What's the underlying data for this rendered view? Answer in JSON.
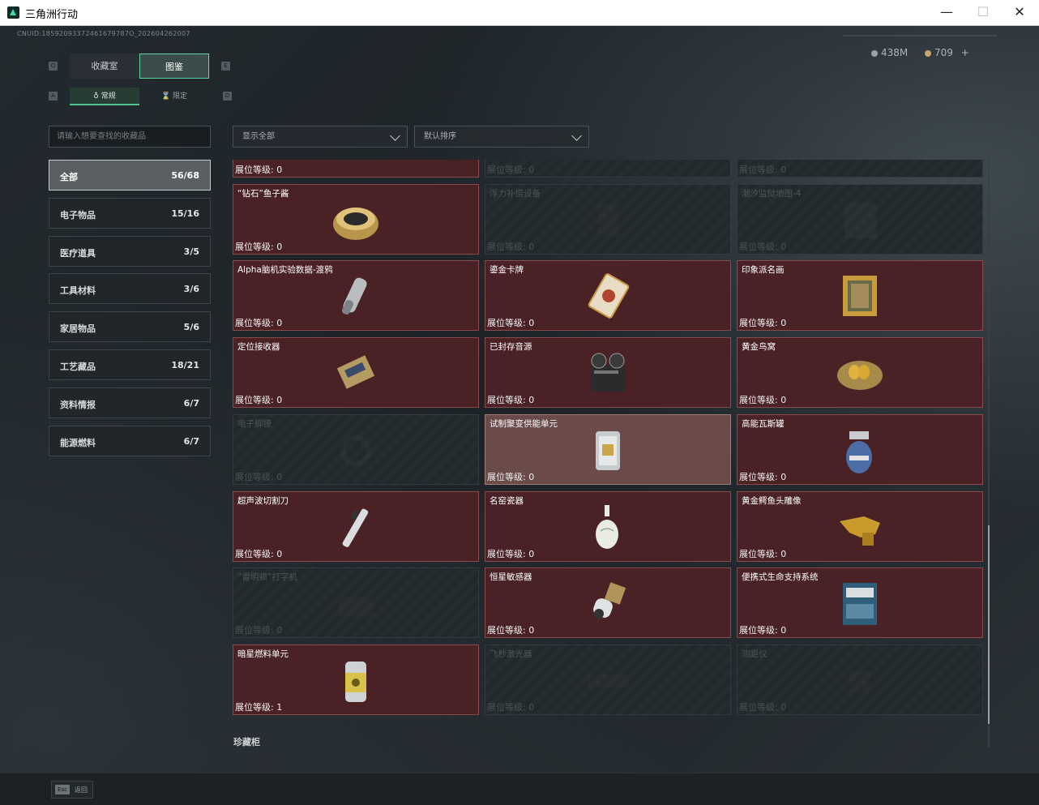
{
  "window": {
    "title": "三角洲行动",
    "minimize": "—",
    "maximize": "☐",
    "close": "✕"
  },
  "header": {
    "uid": "CNUID:18592093372461679787O_202604262007",
    "currency1": "438M",
    "currency2": "709",
    "currency2_add": "+",
    "currency1_color": "#9aa3a8",
    "currency2_color": "#c7a66a"
  },
  "tabs": {
    "collection_room": "收藏室",
    "catalog": "图鉴",
    "left_key": "Q",
    "right_key": "E"
  },
  "subtabs": {
    "regular": "常规",
    "limited": "限定",
    "left_key": "A",
    "right_key": "D"
  },
  "search": {
    "placeholder": "请输入想要查找的收藏品"
  },
  "filters": {
    "display": "显示全部",
    "sort": "默认排序"
  },
  "categories": [
    {
      "label": "全部",
      "count": "56/68",
      "active": true
    },
    {
      "label": "电子物品",
      "count": "15/16"
    },
    {
      "label": "医疗道具",
      "count": "3/5"
    },
    {
      "label": "工具材料",
      "count": "3/6"
    },
    {
      "label": "家居物品",
      "count": "5/6"
    },
    {
      "label": "工艺藏品",
      "count": "18/21"
    },
    {
      "label": "资料情报",
      "count": "6/7"
    },
    {
      "label": "能源燃料",
      "count": "6/7"
    }
  ],
  "items": [
    {
      "name": "",
      "level": "展位等级: 0",
      "locked": false,
      "icon": "gold-item-icon"
    },
    {
      "name": "",
      "level": "展位等级: 0",
      "locked": true,
      "icon": "unknown-icon"
    },
    {
      "name": "",
      "level": "展位等级: 0",
      "locked": true,
      "icon": "unknown-icon"
    },
    {
      "name": "“钻石”鱼子酱",
      "level": "展位等级: 0",
      "locked": false,
      "icon": "caviar-tin-icon"
    },
    {
      "name": "浮力补偿设备",
      "level": "展位等级: 0",
      "locked": true,
      "icon": "bcd-icon"
    },
    {
      "name": "潮汐监狱地图-4",
      "level": "展位等级: 0",
      "locked": true,
      "icon": "map-icon"
    },
    {
      "name": "Alpha脑机实验数据-渡鸦",
      "level": "展位等级: 0",
      "locked": false,
      "icon": "data-cylinder-icon"
    },
    {
      "name": "鎏金卡牌",
      "level": "展位等级: 0",
      "locked": false,
      "icon": "gilded-card-icon"
    },
    {
      "name": "印象派名画",
      "level": "展位等级: 0",
      "locked": false,
      "icon": "painting-icon"
    },
    {
      "name": "定位接收器",
      "level": "展位等级: 0",
      "locked": false,
      "icon": "receiver-icon"
    },
    {
      "name": "已封存音源",
      "level": "展位等级: 0",
      "locked": false,
      "icon": "reel-recorder-icon"
    },
    {
      "name": "黄金鸟窝",
      "level": "展位等级: 0",
      "locked": false,
      "icon": "golden-nest-icon"
    },
    {
      "name": "电子脚镣",
      "level": "展位等级: 0",
      "locked": true,
      "icon": "ankle-monitor-icon"
    },
    {
      "name": "试制聚变供能单元",
      "level": "展位等级: 0",
      "locked": false,
      "highlight": true,
      "icon": "fusion-cell-icon"
    },
    {
      "name": "高能瓦斯罐",
      "level": "展位等级: 0",
      "locked": false,
      "icon": "gas-tank-icon"
    },
    {
      "name": "超声波切割刀",
      "level": "展位等级: 0",
      "locked": false,
      "icon": "ultrasonic-cutter-icon"
    },
    {
      "name": "名窑瓷器",
      "level": "展位等级: 0",
      "locked": false,
      "icon": "porcelain-vase-icon"
    },
    {
      "name": "黄金鳄鱼头雕像",
      "level": "展位等级: 0",
      "locked": false,
      "icon": "gold-croc-icon"
    },
    {
      "name": "“雷明顿”打字机",
      "level": "展位等级: 0",
      "locked": true,
      "icon": "typewriter-icon"
    },
    {
      "name": "恒星敏感器",
      "level": "展位等级: 0",
      "locked": false,
      "icon": "star-sensor-icon"
    },
    {
      "name": "便携式生命支持系统",
      "level": "展位等级: 0",
      "locked": false,
      "icon": "life-support-icon"
    },
    {
      "name": "暗星燃料单元",
      "level": "展位等级: 1",
      "locked": false,
      "icon": "fuel-cell-icon"
    },
    {
      "name": "飞秒激光器",
      "level": "展位等级: 0",
      "locked": true,
      "icon": "laser-icon"
    },
    {
      "name": "测距仪",
      "level": "展位等级: 0",
      "locked": true,
      "icon": "rangefinder-icon"
    }
  ],
  "section": {
    "title": "珍藏柜"
  },
  "footer": {
    "esc_key": "Esc",
    "esc_label": "返回"
  }
}
